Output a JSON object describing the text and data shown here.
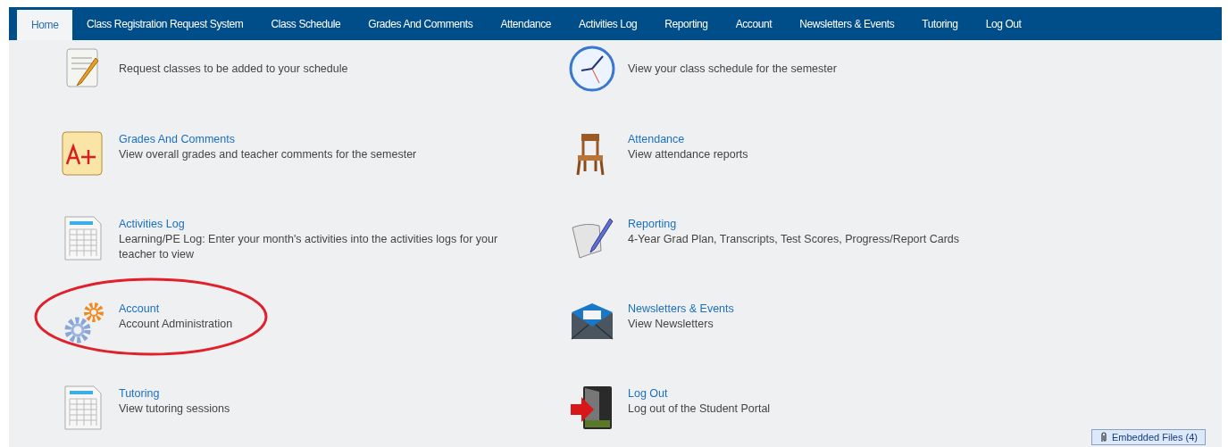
{
  "nav": [
    {
      "label": "Home",
      "selected": true
    },
    {
      "label": "Class Registration Request System",
      "selected": false
    },
    {
      "label": "Class Schedule",
      "selected": false
    },
    {
      "label": "Grades And Comments",
      "selected": false
    },
    {
      "label": "Attendance",
      "selected": false
    },
    {
      "label": "Activities Log",
      "selected": false
    },
    {
      "label": "Reporting",
      "selected": false
    },
    {
      "label": "Account",
      "selected": false
    },
    {
      "label": "Newsletters & Events",
      "selected": false
    },
    {
      "label": "Tutoring",
      "selected": false
    },
    {
      "label": "Log Out",
      "selected": false
    }
  ],
  "items": [
    {
      "kind": "notepad",
      "description": "Request classes to be added to your schedule",
      "highlighted": false
    },
    {
      "kind": "clock",
      "description": "View your class schedule for the semester",
      "highlighted": false
    },
    {
      "kind": "grade",
      "title": "Grades And Comments",
      "description": "View overall grades and teacher comments for the semester",
      "highlighted": false
    },
    {
      "kind": "chair",
      "title": "Attendance",
      "description": "View attendance reports",
      "highlighted": false
    },
    {
      "kind": "sheet",
      "title": "Activities Log",
      "description": "Learning/PE Log: Enter your month's activities into the activities logs for your teacher to view",
      "highlighted": false
    },
    {
      "kind": "paper",
      "title": "Reporting",
      "description": "4-Year Grad Plan, Transcripts, Test Scores, Progress/Report Cards",
      "highlighted": false
    },
    {
      "kind": "gears",
      "title": "Account",
      "description": "Account Administration",
      "highlighted": true
    },
    {
      "kind": "envelope",
      "title": "Newsletters & Events",
      "description": "View Newsletters",
      "highlighted": false
    },
    {
      "kind": "sheet",
      "title": "Tutoring",
      "description": "View tutoring sessions",
      "highlighted": false
    },
    {
      "kind": "door",
      "title": "Log Out",
      "description": "Log out of the Student Portal",
      "highlighted": false
    }
  ],
  "embedded_files": {
    "label": "Embedded Files (4)"
  }
}
